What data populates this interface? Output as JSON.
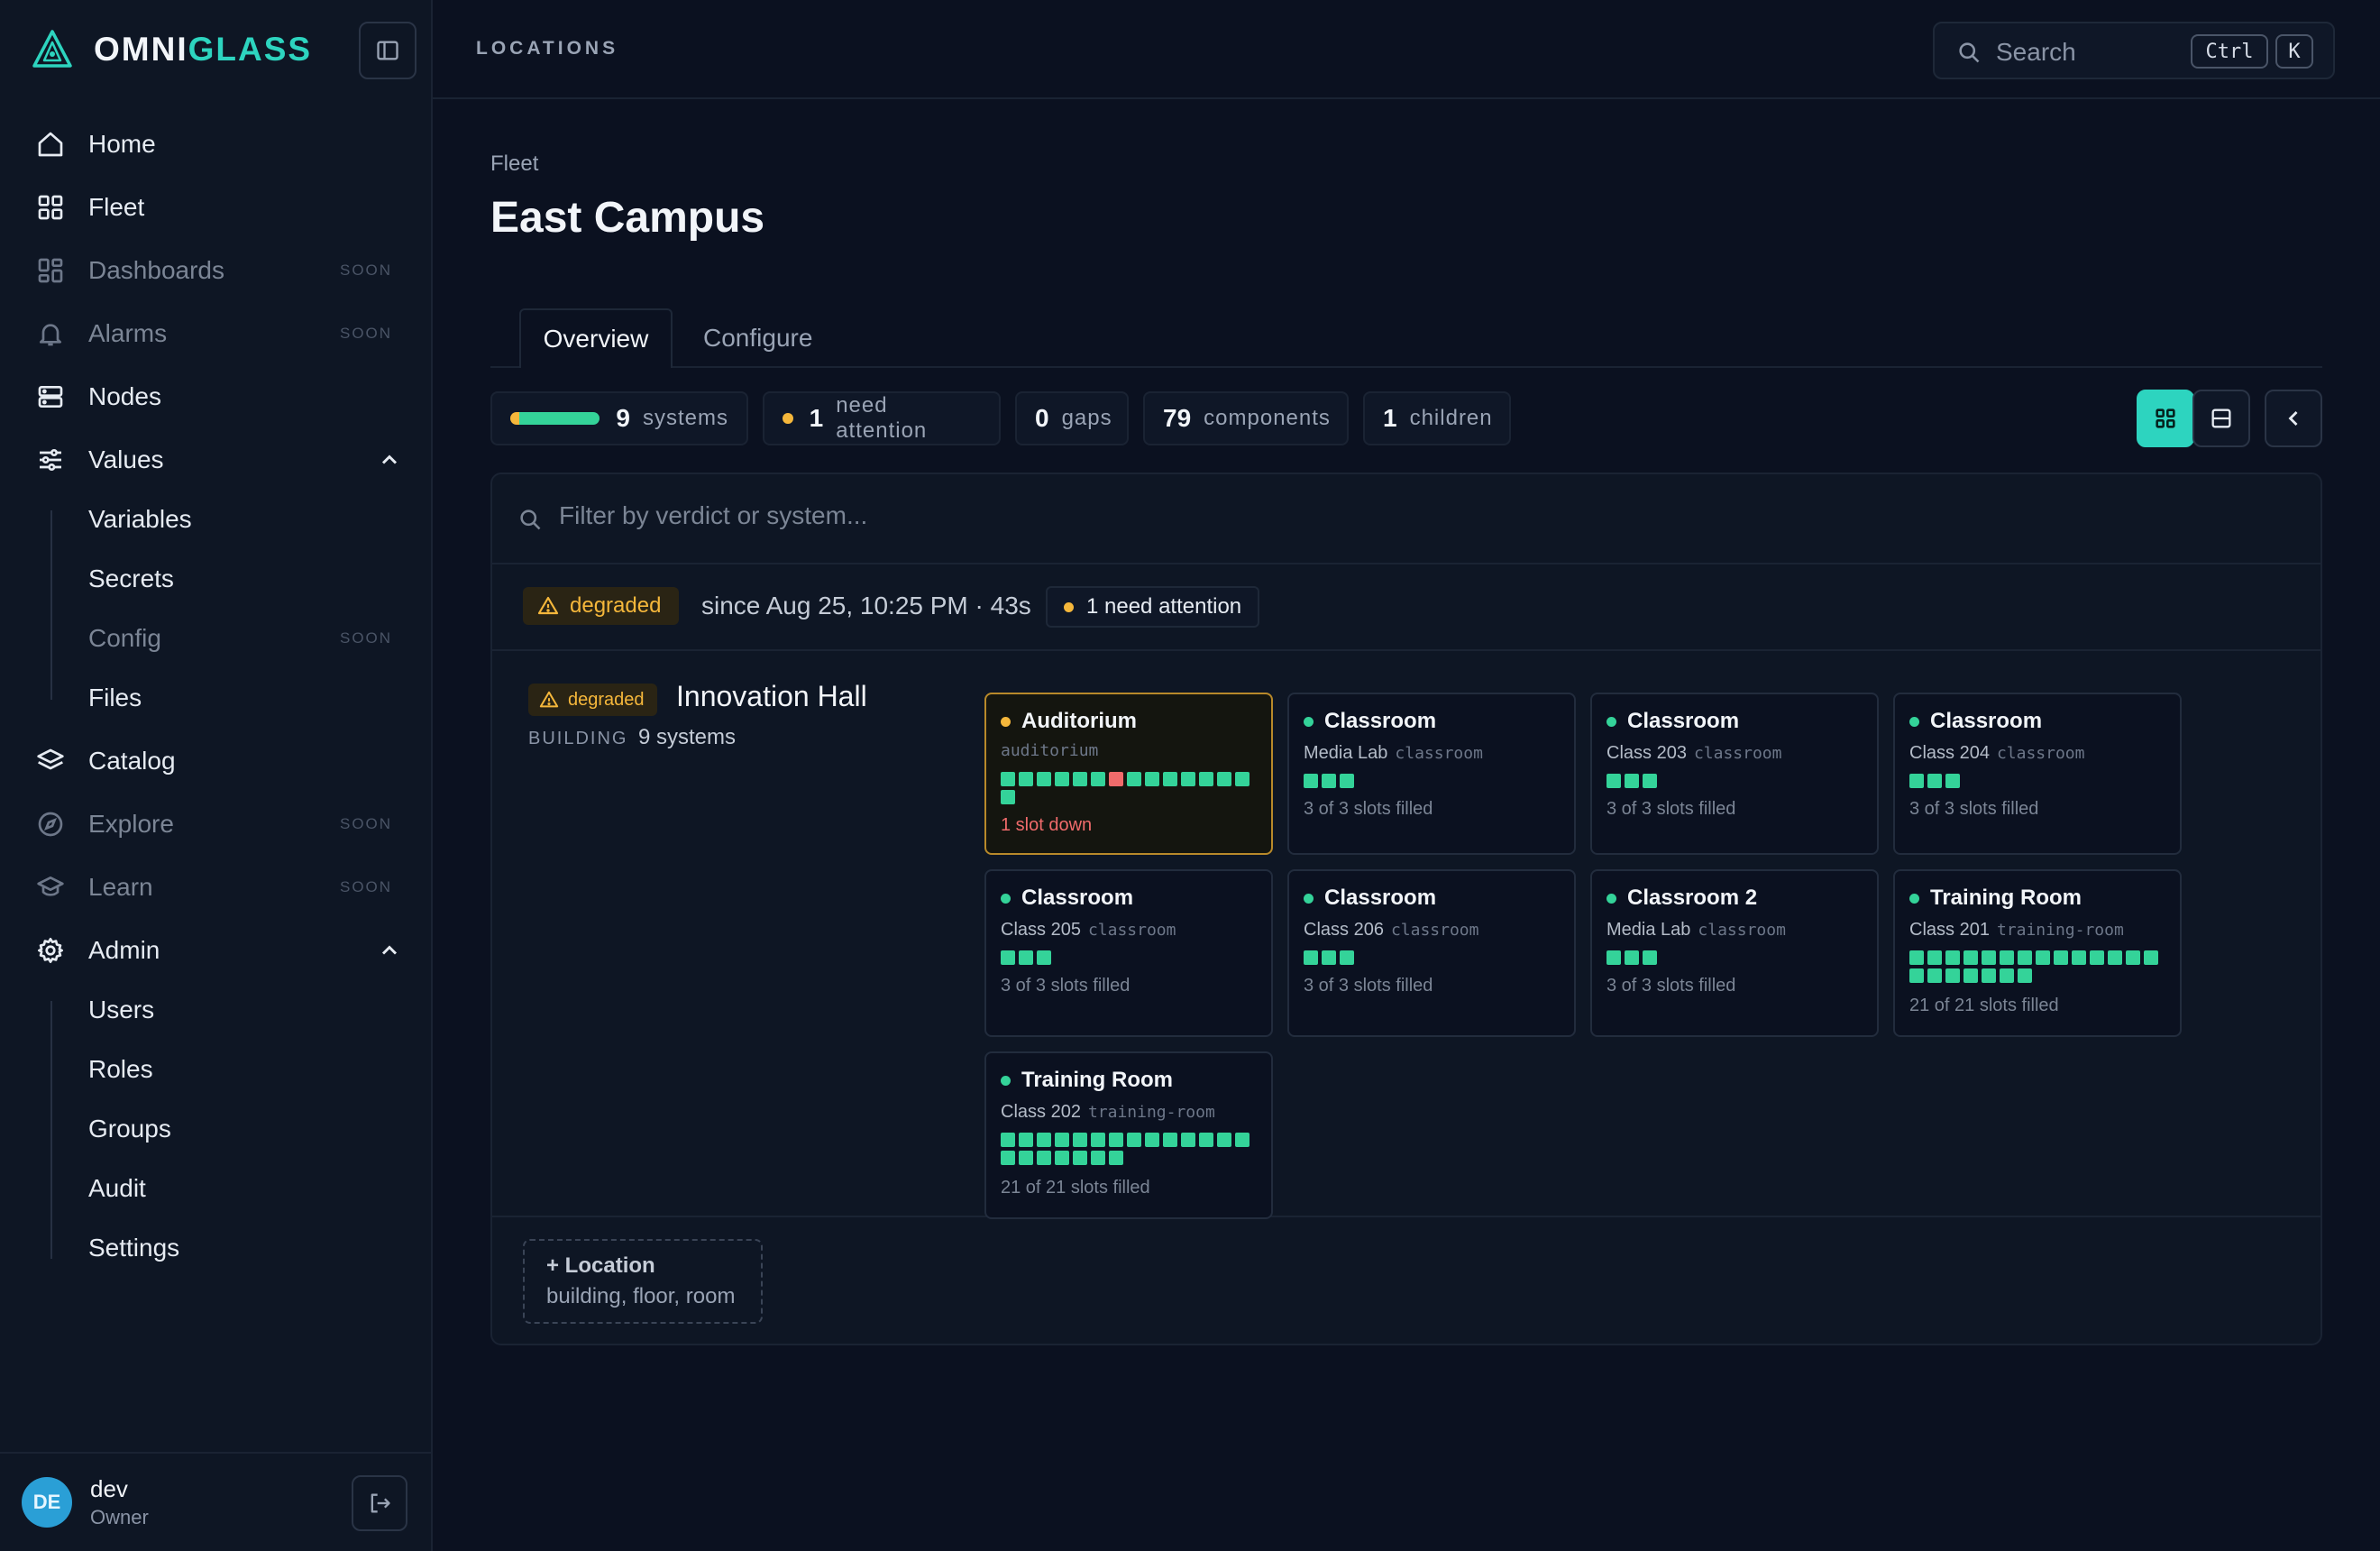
{
  "brand": {
    "part1": "OMNI",
    "part2": "GLASS"
  },
  "sidebar": {
    "items": [
      {
        "label": "Home",
        "icon": "home-icon"
      },
      {
        "label": "Fleet",
        "icon": "grid-icon"
      },
      {
        "label": "Dashboards",
        "icon": "dashboard-icon",
        "soon": "SOON"
      },
      {
        "label": "Alarms",
        "icon": "bell-icon",
        "soon": "SOON"
      },
      {
        "label": "Nodes",
        "icon": "server-icon"
      },
      {
        "label": "Values",
        "icon": "sliders-icon",
        "expanded": true
      },
      {
        "label": "Catalog",
        "icon": "layers-icon"
      },
      {
        "label": "Explore",
        "icon": "compass-icon",
        "soon": "SOON"
      },
      {
        "label": "Learn",
        "icon": "graduation-cap-icon",
        "soon": "SOON"
      },
      {
        "label": "Admin",
        "icon": "gear-icon",
        "expanded": true
      }
    ],
    "values_sub": [
      {
        "label": "Variables"
      },
      {
        "label": "Secrets"
      },
      {
        "label": "Config",
        "soon": "SOON"
      },
      {
        "label": "Files"
      }
    ],
    "admin_sub": [
      {
        "label": "Users"
      },
      {
        "label": "Roles"
      },
      {
        "label": "Groups"
      },
      {
        "label": "Audit"
      },
      {
        "label": "Settings"
      }
    ]
  },
  "user": {
    "initials": "DE",
    "name": "dev",
    "role": "Owner"
  },
  "topbar": {
    "section": "LOCATIONS",
    "search_placeholder": "Search",
    "kbd1": "Ctrl",
    "kbd2": "K"
  },
  "page": {
    "breadcrumb": "Fleet",
    "title": "East Campus",
    "tabs": [
      "Overview",
      "Configure"
    ]
  },
  "stats": {
    "systems": {
      "value": "9",
      "label": "systems",
      "healthy_fraction": 0.9
    },
    "attention": {
      "value": "1",
      "label": "need attention"
    },
    "gaps": {
      "value": "0",
      "label": "gaps"
    },
    "components": {
      "value": "79",
      "label": "components"
    },
    "children": {
      "value": "1",
      "label": "children"
    }
  },
  "filter": {
    "placeholder": "Filter by verdict or system..."
  },
  "verdict": {
    "status": "degraded",
    "since": "since Aug 25, 10:25 PM · 43s",
    "attention": "1 need attention"
  },
  "group": {
    "status": "degraded",
    "name": "Innovation Hall",
    "type": "BUILDING",
    "count": "9 systems"
  },
  "systems": [
    {
      "title": "Auditorium",
      "sub": "",
      "kind": "auditorium",
      "slots": 15,
      "down_index": 6,
      "footer": "1 slot down",
      "status": "warn"
    },
    {
      "title": "Classroom",
      "sub": "Media Lab",
      "kind": "classroom",
      "slots": 3,
      "footer": "3 of 3 slots filled",
      "status": "ok"
    },
    {
      "title": "Classroom",
      "sub": "Class 203",
      "kind": "classroom",
      "slots": 3,
      "footer": "3 of 3 slots filled",
      "status": "ok"
    },
    {
      "title": "Classroom",
      "sub": "Class 204",
      "kind": "classroom",
      "slots": 3,
      "footer": "3 of 3 slots filled",
      "status": "ok"
    },
    {
      "title": "Classroom",
      "sub": "Class 205",
      "kind": "classroom",
      "slots": 3,
      "footer": "3 of 3 slots filled",
      "status": "ok"
    },
    {
      "title": "Classroom",
      "sub": "Class 206",
      "kind": "classroom",
      "slots": 3,
      "footer": "3 of 3 slots filled",
      "status": "ok"
    },
    {
      "title": "Classroom 2",
      "sub": "Media Lab",
      "kind": "classroom",
      "slots": 3,
      "footer": "3 of 3 slots filled",
      "status": "ok"
    },
    {
      "title": "Training Room",
      "sub": "Class 201",
      "kind": "training-room",
      "slots": 21,
      "footer": "21 of 21 slots filled",
      "status": "ok"
    },
    {
      "title": "Training Room",
      "sub": "Class 202",
      "kind": "training-room",
      "slots": 21,
      "footer": "21 of 21 slots filled",
      "status": "ok"
    }
  ],
  "add_location": {
    "label": "+ Location",
    "hint": "building, floor, room"
  },
  "colors": {
    "accent": "#2dd4bf",
    "ok": "#34d399",
    "warn": "#f5b73b",
    "down": "#f06b6b"
  }
}
